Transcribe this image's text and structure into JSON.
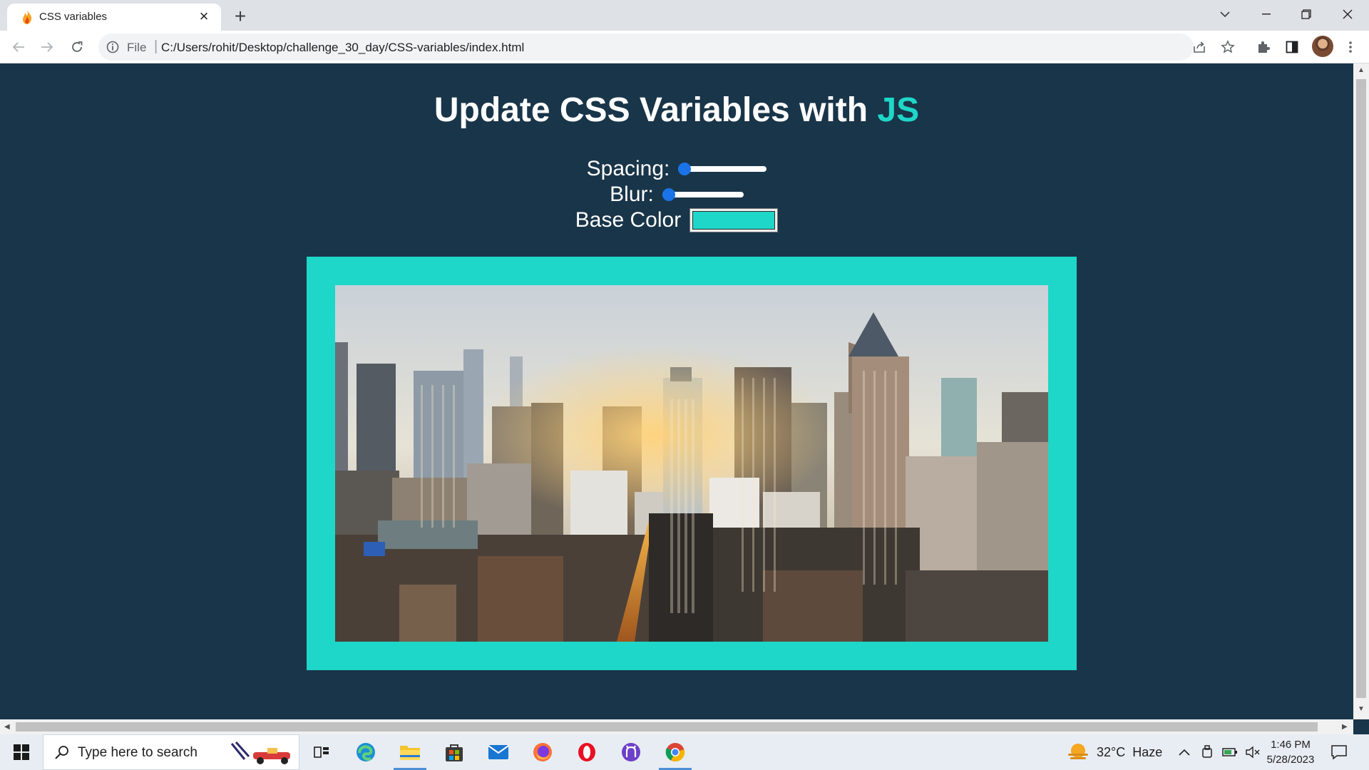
{
  "browser": {
    "tab_title": "CSS variables",
    "url_scheme": "File",
    "url": "C:/Users/rohit/Desktop/challenge_30_day/CSS-variables/index.html"
  },
  "page": {
    "heading_prefix": "Update CSS Variables with ",
    "heading_accent": "JS",
    "spacing_label": "Spacing:",
    "spacing_value": 10,
    "spacing_range": [
      10,
      200
    ],
    "blur_label": "Blur:",
    "blur_value": 0,
    "blur_range": [
      0,
      25
    ],
    "base_color_label": "Base Color",
    "base_color": "#1ed7c8"
  },
  "colors": {
    "page_background": "#193549",
    "accent": "#1ed7c8",
    "slider_knob": "#1a73e8"
  },
  "taskbar": {
    "search_placeholder": "Type here to search",
    "weather_temp": "32°C",
    "weather_desc": "Haze",
    "time": "1:46 PM",
    "date": "5/28/2023",
    "apps": [
      "task-view",
      "edge",
      "file-explorer",
      "microsoft-store",
      "mail",
      "firefox",
      "opera",
      "github-desktop",
      "chrome"
    ]
  }
}
